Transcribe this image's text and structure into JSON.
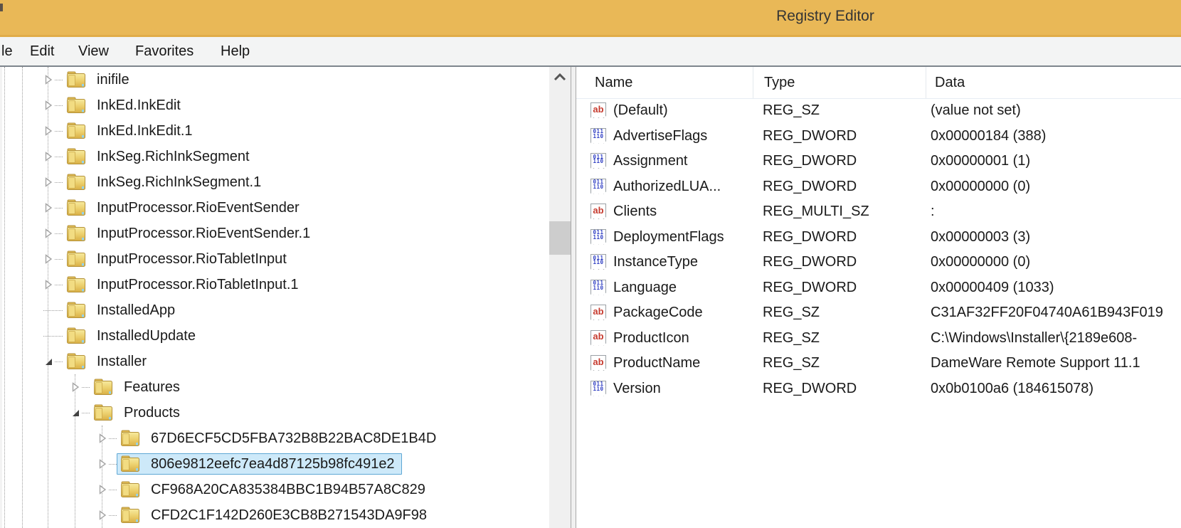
{
  "window": {
    "title": "Registry Editor"
  },
  "menu": {
    "items": [
      {
        "id": "file",
        "label": "le"
      },
      {
        "id": "edit",
        "label": "Edit"
      },
      {
        "id": "view",
        "label": "View"
      },
      {
        "id": "favorites",
        "label": "Favorites"
      },
      {
        "id": "help",
        "label": "Help"
      }
    ]
  },
  "tree": {
    "items": [
      {
        "label": "inifile",
        "level": 0,
        "arrow": "collapsed",
        "selected": false
      },
      {
        "label": "InkEd.InkEdit",
        "level": 0,
        "arrow": "collapsed",
        "selected": false
      },
      {
        "label": "InkEd.InkEdit.1",
        "level": 0,
        "arrow": "collapsed",
        "selected": false
      },
      {
        "label": "InkSeg.RichInkSegment",
        "level": 0,
        "arrow": "collapsed",
        "selected": false
      },
      {
        "label": "InkSeg.RichInkSegment.1",
        "level": 0,
        "arrow": "collapsed",
        "selected": false
      },
      {
        "label": "InputProcessor.RioEventSender",
        "level": 0,
        "arrow": "collapsed",
        "selected": false
      },
      {
        "label": "InputProcessor.RioEventSender.1",
        "level": 0,
        "arrow": "collapsed",
        "selected": false
      },
      {
        "label": "InputProcessor.RioTabletInput",
        "level": 0,
        "arrow": "collapsed",
        "selected": false
      },
      {
        "label": "InputProcessor.RioTabletInput.1",
        "level": 0,
        "arrow": "collapsed",
        "selected": false
      },
      {
        "label": "InstalledApp",
        "level": 0,
        "arrow": "none",
        "selected": false
      },
      {
        "label": "InstalledUpdate",
        "level": 0,
        "arrow": "none",
        "selected": false
      },
      {
        "label": "Installer",
        "level": 0,
        "arrow": "expanded",
        "selected": false
      },
      {
        "label": "Features",
        "level": 1,
        "arrow": "collapsed",
        "selected": false
      },
      {
        "label": "Products",
        "level": 1,
        "arrow": "expanded",
        "selected": false
      },
      {
        "label": "67D6ECF5CD5FBA732B8B22BAC8DE1B4D",
        "level": 2,
        "arrow": "collapsed",
        "selected": false
      },
      {
        "label": "806e9812eefc7ea4d87125b98fc491e2",
        "level": 2,
        "arrow": "collapsed",
        "selected": true
      },
      {
        "label": "CF968A20CA835384BBC1B94B57A8C829",
        "level": 2,
        "arrow": "collapsed",
        "selected": false
      },
      {
        "label": "CFD2C1F142D260E3CB8B271543DA9F98",
        "level": 2,
        "arrow": "collapsed",
        "selected": false
      }
    ]
  },
  "values": {
    "columns": [
      "Name",
      "Type",
      "Data"
    ],
    "rows": [
      {
        "icon": "string-value-icon",
        "name": "(Default)",
        "type": "REG_SZ",
        "data": "(value not set)"
      },
      {
        "icon": "dword-value-icon",
        "name": "AdvertiseFlags",
        "type": "REG_DWORD",
        "data": "0x00000184 (388)"
      },
      {
        "icon": "dword-value-icon",
        "name": "Assignment",
        "type": "REG_DWORD",
        "data": "0x00000001 (1)"
      },
      {
        "icon": "dword-value-icon",
        "name": "AuthorizedLUA...",
        "type": "REG_DWORD",
        "data": "0x00000000 (0)"
      },
      {
        "icon": "string-value-icon",
        "name": "Clients",
        "type": "REG_MULTI_SZ",
        "data": ":"
      },
      {
        "icon": "dword-value-icon",
        "name": "DeploymentFlags",
        "type": "REG_DWORD",
        "data": "0x00000003 (3)"
      },
      {
        "icon": "dword-value-icon",
        "name": "InstanceType",
        "type": "REG_DWORD",
        "data": "0x00000000 (0)"
      },
      {
        "icon": "dword-value-icon",
        "name": "Language",
        "type": "REG_DWORD",
        "data": "0x00000409 (1033)"
      },
      {
        "icon": "string-value-icon",
        "name": "PackageCode",
        "type": "REG_SZ",
        "data": "C31AF32FF20F04740A61B943F019"
      },
      {
        "icon": "string-value-icon",
        "name": "ProductIcon",
        "type": "REG_SZ",
        "data": "C:\\Windows\\Installer\\{2189e608-"
      },
      {
        "icon": "string-value-icon",
        "name": "ProductName",
        "type": "REG_SZ",
        "data": "DameWare Remote Support 11.1"
      },
      {
        "icon": "dword-value-icon",
        "name": "Version",
        "type": "REG_DWORD",
        "data": "0x0b0100a6 (184615078)"
      }
    ]
  },
  "colors": {
    "titlebar_background": "#e9b857",
    "selection_fill": "#cde9f9",
    "selection_border": "#5fa8d5",
    "string_icon_red": "#c63a2e",
    "dword_icon_blue": "#3140c4"
  }
}
